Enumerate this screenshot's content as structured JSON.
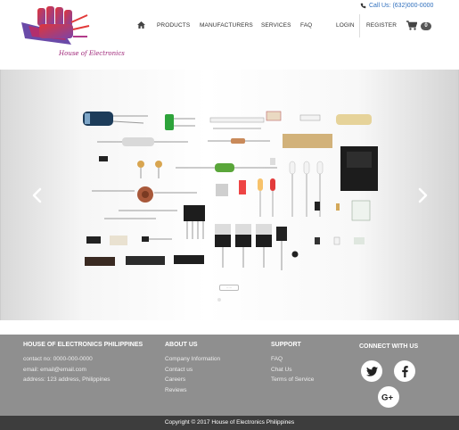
{
  "header": {
    "logo_text": "House of Electronics",
    "call_us": "Call Us: (632)000-0000",
    "nav": [
      {
        "label": "PRODUCTS"
      },
      {
        "label": "MANUFACTURERS"
      },
      {
        "label": "SERVICES"
      },
      {
        "label": "FAQ"
      },
      {
        "label": "LOGIN"
      },
      {
        "label": "REGISTER"
      }
    ],
    "cart_count": "0"
  },
  "slider": {
    "indicator_text": "·····"
  },
  "footer": {
    "company": {
      "heading": "HOUSE OF ELECTRONICS PHILIPPINES",
      "contact": "contact no: 0000-000-0000",
      "email": "email: email@email.com",
      "address": "address: 123 address, Philippines"
    },
    "about": {
      "heading": "ABOUT US",
      "links": [
        "Company Information",
        "Contact us",
        "Careers",
        "Reviews"
      ]
    },
    "support": {
      "heading": "SUPPORT",
      "links": [
        "FAQ",
        "Chat Us",
        "Terms of Service"
      ]
    },
    "connect": {
      "heading": "CONNECT WITH US",
      "icons": [
        "twitter-icon",
        "facebook-icon",
        "google-plus-icon"
      ]
    },
    "copyright": "Copyright © 2017 House of Electronics Philippines"
  },
  "colors": {
    "logo_red": "#d9313a",
    "logo_purple": "#8a3fa0",
    "link_blue": "#2f6fbd",
    "footer_bg": "#8f8f8f",
    "copyright_bg": "#3d3d3d"
  }
}
